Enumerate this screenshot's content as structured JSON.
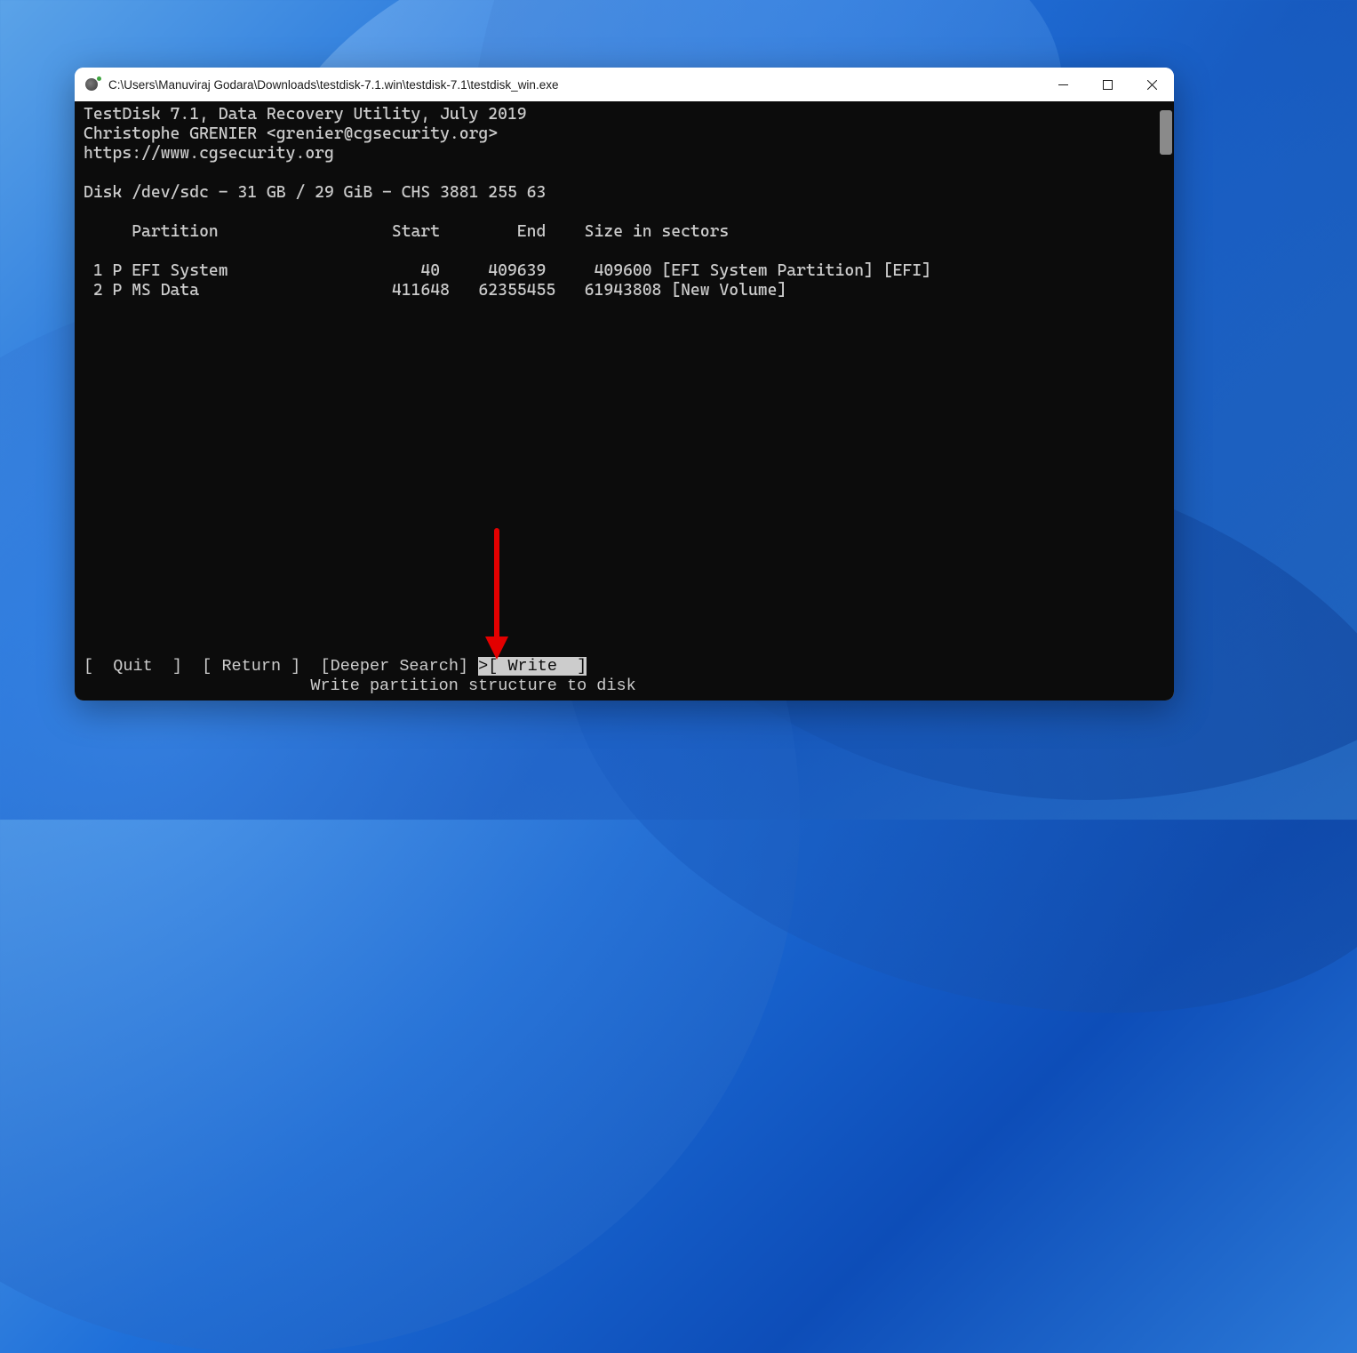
{
  "window": {
    "title": "C:\\Users\\Manuviraj Godara\\Downloads\\testdisk-7.1.win\\testdisk-7.1\\testdisk_win.exe"
  },
  "header": {
    "line1": "TestDisk 7.1, Data Recovery Utility, July 2019",
    "line2": "Christophe GRENIER <grenier@cgsecurity.org>",
    "line3": "https://www.cgsecurity.org"
  },
  "disk_line": "Disk /dev/sdc - 31 GB / 29 GiB - CHS 3881 255 63",
  "columns_header": "     Partition                  Start        End    Size in sectors",
  "partitions": [
    " 1 P EFI System                    40     409639     409600 [EFI System Partition] [EFI]",
    " 2 P MS Data                    411648   62355455   61943808 [New Volume]"
  ],
  "menu": {
    "quit": "[  Quit  ]",
    "return": "[ Return ]",
    "deeper": "[Deeper Search]",
    "write_prefix": ">",
    "write": "[ Write  ]"
  },
  "help_line": "                       Write partition structure to disk"
}
